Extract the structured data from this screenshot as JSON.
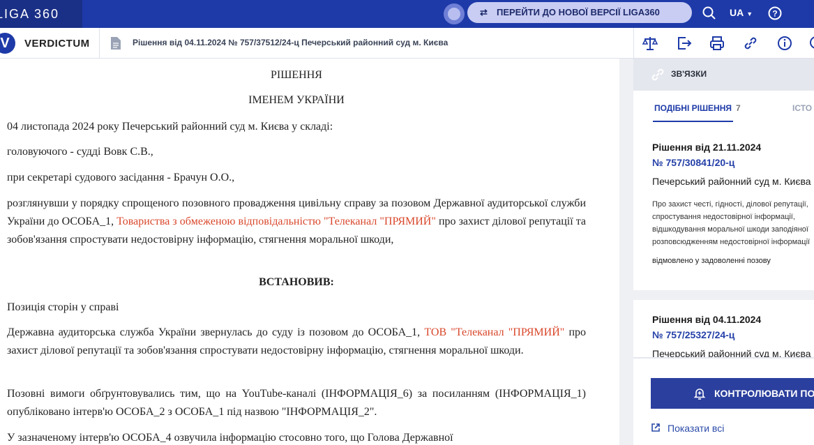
{
  "topbar": {
    "logo": "LIGA 360",
    "promo_label": "ПЕРЕЙТИ ДО НОВОЇ ВЕРСІЇ LIGA360",
    "lang": "UA",
    "accent": "#1e3aa8"
  },
  "subbar": {
    "brand": "VERDICTUM",
    "doc_title": "Рішення від 04.11.2024 № 757/37512/24-ц Печерський районний суд м. Києва"
  },
  "document": {
    "heading1": "РІШЕННЯ",
    "heading2": "ІМЕНЕМ УКРАЇНИ",
    "p1": "04 листопада 2024 року Печерський районний суд м. Києва у складі:",
    "p2": "головуючого - судді Вовк С.В.,",
    "p3": "при секретарі судового засідання - Брачун О.О.,",
    "p4_a": "розглянувши у порядку спрощеного позовного провадження цивільну справу за позовом Державної аудиторської служби України до ОСОБА_1, ",
    "p4_link": "Товариства з обмеженою відповідальністю \"Телеканал \"ПРЯМИЙ\"",
    "p4_b": " про захист ділової репутації та зобов'язання спростувати недостовірну інформацію, стягнення моральної шкоди,",
    "established": "ВСТАНОВИВ:",
    "p5": "Позиція сторін у справі",
    "p6_a": "Державна аудиторська служба України звернулась до суду із позовом до ОСОБА_1, ",
    "p6_link": "ТОВ \"Телеканал \"ПРЯМИЙ\"",
    "p6_b": " про захист ділової репутації та зобов'язання спростувати недостовірну інформацію, стягнення моральної шкоди.",
    "p7": "Позовні вимоги обґрунтовувались тим, що на YouTube-каналі (ІНФОРМАЦІЯ_6) за посиланням (ІНФОРМАЦІЯ_1) опубліковано інтерв'ю ОСОБА_2 з ОСОБА_1 під назвою \"ІНФОРМАЦІЯ_2\".",
    "p8": "У зазначеному інтерв'ю ОСОБА_4 озвучила інформацію стосовно того, що Голова Державної"
  },
  "panel": {
    "header": "ЗВ'ЯЗКИ",
    "tab_similar": "ПОДІБНІ РІШЕННЯ",
    "tab_similar_count": "7",
    "tab_history": "ІСТО",
    "cards": [
      {
        "date": "Рішення від 21.11.2024",
        "number": "№ 757/30841/20-ц",
        "court": "Печерський районний суд м. Києва",
        "desc": "Про захист честі, гідності, ділової репутації, спростування недостовірної інформації, відшкодування моральної шкоди заподіяної розповсюдженням недостовірної інформації",
        "result": "відмовлено у задоволенні позову"
      },
      {
        "date": "Рішення від 04.11.2024",
        "number": "№ 757/25327/24-ц",
        "court": "Печерський районний суд м. Києва"
      }
    ],
    "control_button": "КОНТРОЛЮВАТИ ПОДІЮ",
    "show_all": "Показати всі"
  }
}
